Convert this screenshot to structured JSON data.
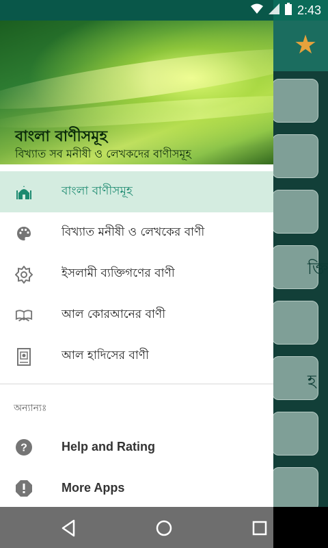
{
  "status_bar": {
    "time": "2:43"
  },
  "drawer": {
    "header": {
      "title": "বাংলা বাণীসমূহ",
      "subtitle": "বিখ্যাত সব মনীষী ও লেখকদের বাণীসমূহ"
    },
    "items": [
      {
        "label": "বাংলা বাণীসমূহ",
        "icon": "mosque-icon",
        "active": true
      },
      {
        "label": "বিখ্যাত মনীষী ও লেখকের বাণী",
        "icon": "palette-icon",
        "active": false
      },
      {
        "label": "ইসলামী ব্যক্তিগণের বাণী",
        "icon": "star-gear-icon",
        "active": false
      },
      {
        "label": "আল কোরআনের বাণী",
        "icon": "open-book-icon",
        "active": false
      },
      {
        "label": "আল হাদিসের বাণী",
        "icon": "book-icon",
        "active": false
      }
    ],
    "other_section_label": "অন্যান্যঃ",
    "other_items": [
      {
        "label": "Help and Rating",
        "icon": "help-icon"
      },
      {
        "label": "More Apps",
        "icon": "alert-icon"
      }
    ]
  },
  "background_app": {
    "favorite_icon": "star-icon",
    "visible_glyphs": [
      "ক্তি",
      "হ"
    ]
  },
  "colors": {
    "accent": "#1c8a70",
    "active_bg": "#d4ece0",
    "status_bar": "#0b6b59",
    "star": "#e6a23c"
  }
}
